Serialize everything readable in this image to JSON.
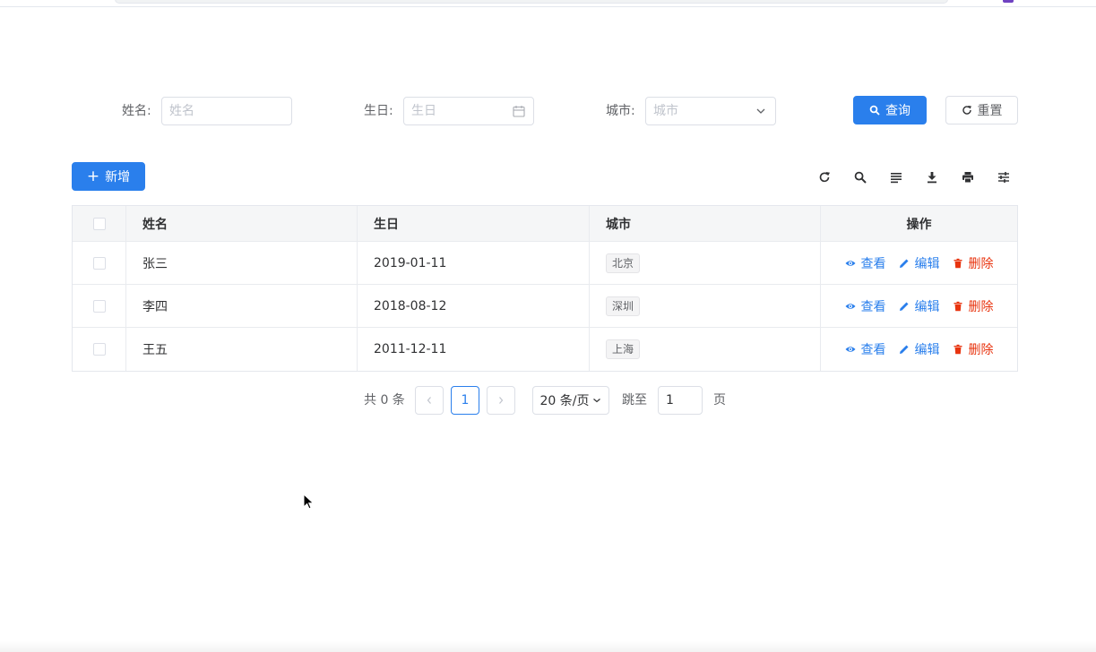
{
  "search_form": {
    "name": {
      "label": "姓名:",
      "placeholder": "姓名"
    },
    "birthday": {
      "label": "生日:",
      "placeholder": "生日"
    },
    "city": {
      "label": "城市:",
      "placeholder": "城市"
    },
    "query_button": "查询",
    "reset_button": "重置"
  },
  "toolbar": {
    "add_button": "新增",
    "icons": [
      "refresh-icon",
      "search-icon",
      "density-icon",
      "download-icon",
      "print-icon",
      "column-settings-icon"
    ]
  },
  "table": {
    "columns": [
      "姓名",
      "生日",
      "城市",
      "操作"
    ],
    "rows": [
      {
        "name": "张三",
        "birthday": "2019-01-11",
        "city": "北京"
      },
      {
        "name": "李四",
        "birthday": "2018-08-12",
        "city": "深圳"
      },
      {
        "name": "王五",
        "birthday": "2011-12-11",
        "city": "上海"
      }
    ],
    "actions": {
      "view": "查看",
      "edit": "编辑",
      "delete": "删除"
    }
  },
  "pagination": {
    "total_text": "共 0 条",
    "current_page": "1",
    "page_size": "20 条/页",
    "jump_label": "跳至",
    "jump_value": "1",
    "page_suffix": "页"
  },
  "colors": {
    "primary": "#2a7fec",
    "danger": "#e8340f"
  }
}
